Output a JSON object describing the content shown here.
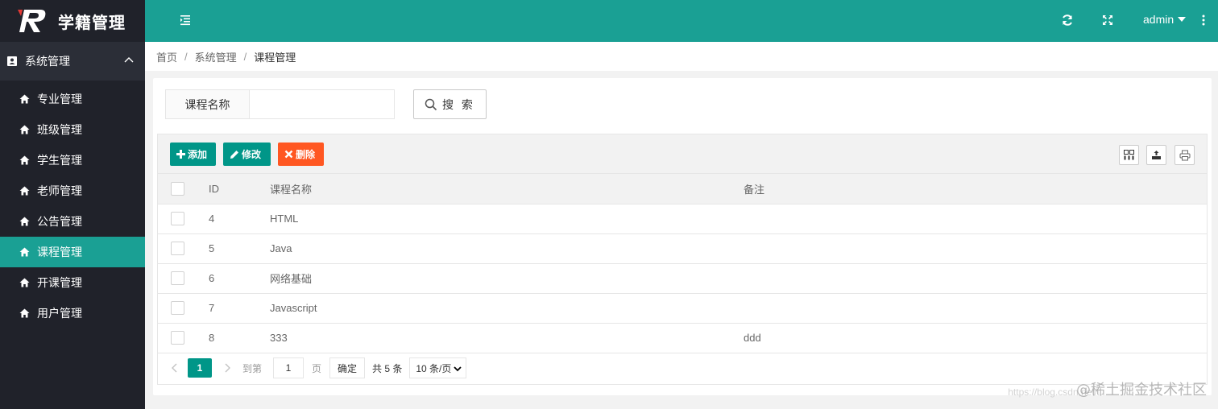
{
  "app": {
    "title": "学籍管理"
  },
  "sidebar": {
    "group_label": "系统管理",
    "items": [
      {
        "label": "专业管理"
      },
      {
        "label": "班级管理"
      },
      {
        "label": "学生管理"
      },
      {
        "label": "老师管理"
      },
      {
        "label": "公告管理"
      },
      {
        "label": "课程管理",
        "active": true
      },
      {
        "label": "开课管理"
      },
      {
        "label": "用户管理"
      }
    ]
  },
  "header": {
    "user": "admin"
  },
  "breadcrumb": {
    "items": [
      "首页",
      "系统管理",
      "课程管理"
    ]
  },
  "search": {
    "label": "课程名称",
    "value": "",
    "button_label": "搜 索"
  },
  "toolbar": {
    "add_label": "添加",
    "edit_label": "修改",
    "delete_label": "删除"
  },
  "table": {
    "columns": [
      "ID",
      "课程名称",
      "备注"
    ],
    "rows": [
      {
        "id": "4",
        "name": "HTML",
        "note": ""
      },
      {
        "id": "5",
        "name": "Java",
        "note": ""
      },
      {
        "id": "6",
        "name": "网络基础",
        "note": ""
      },
      {
        "id": "7",
        "name": "Javascript",
        "note": ""
      },
      {
        "id": "8",
        "name": "333",
        "note": "ddd"
      }
    ]
  },
  "pager": {
    "current": "1",
    "goto_label": "到第",
    "goto_value": "1",
    "page_label": "页",
    "confirm_label": "确定",
    "total_label": "共 5 条",
    "per_page_label": "10 条/页"
  },
  "watermark": {
    "text": "@稀土掘金技术社区",
    "url": "https://blog.csdn.net/..."
  },
  "colors": {
    "primary": "#1aa094",
    "button_primary": "#009688",
    "button_danger": "#ff5722",
    "sidebar_bg": "#20222a"
  }
}
